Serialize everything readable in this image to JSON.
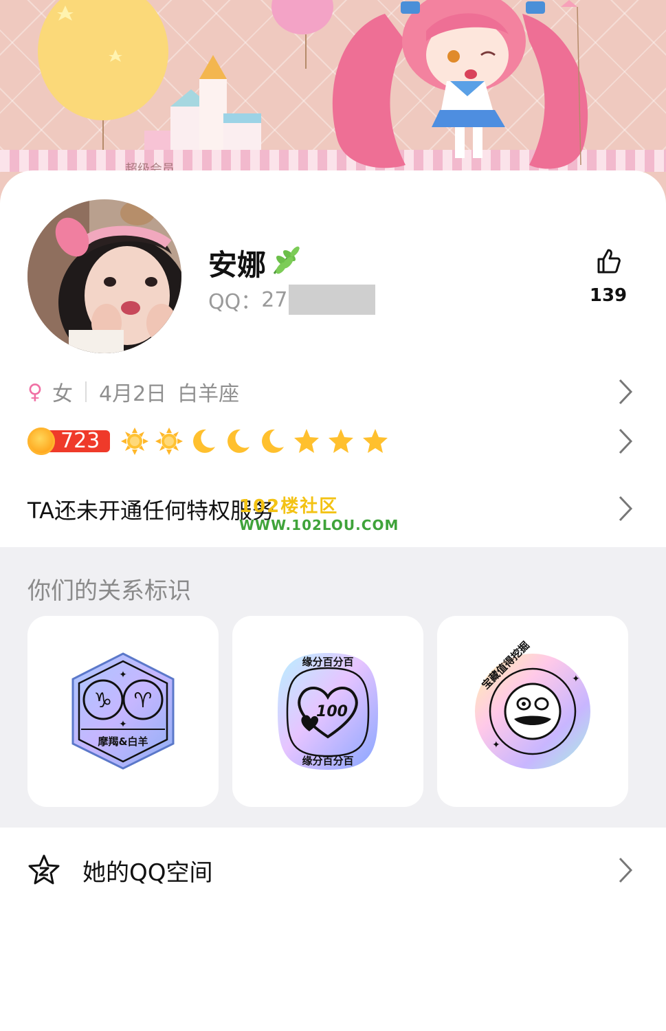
{
  "cover": {
    "faded_text": "超级会员"
  },
  "profile": {
    "name": "安娜",
    "name_decoration": "leaf-emoji",
    "qq_label": "QQ：",
    "qq_visible": "27",
    "like_count": "139"
  },
  "info": {
    "gender_symbol": "♀",
    "gender": "女",
    "birthday": "4月2日",
    "zodiac": "白羊座"
  },
  "level": {
    "value": "723",
    "icons": [
      "sun",
      "sun",
      "moon",
      "moon",
      "moon",
      "star",
      "star",
      "star"
    ]
  },
  "privilege": {
    "text": "TA还未开通任何特权服务"
  },
  "watermark": {
    "line1": "102楼社区",
    "line2": "WWW.102LOU.COM"
  },
  "relation": {
    "title": "你们的关系标识",
    "badges": [
      {
        "icon": "zodiac-badge",
        "label": "摩羯&白羊"
      },
      {
        "icon": "heart-100-badge",
        "label": "缘分百分百"
      },
      {
        "icon": "treasure-badge",
        "label": "宝藏值得挖掘"
      }
    ]
  },
  "qzone": {
    "label": "她的QQ空间"
  },
  "colors": {
    "accent_female": "#f06fa4",
    "level_pill": "#ef3a2a",
    "section_bg": "#f0f0f3"
  }
}
